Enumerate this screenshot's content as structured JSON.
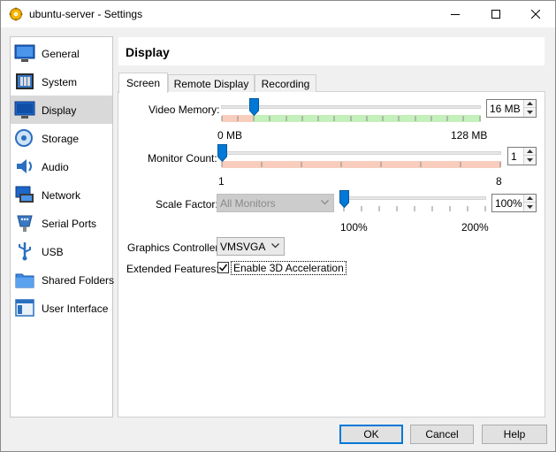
{
  "window": {
    "title": "ubuntu-server - Settings",
    "controls": [
      "minimize-icon",
      "maximize-icon",
      "close-icon"
    ]
  },
  "sidebar": {
    "items": [
      {
        "label": "General",
        "icon": "general-icon"
      },
      {
        "label": "System",
        "icon": "system-icon"
      },
      {
        "label": "Display",
        "icon": "display-icon",
        "selected": true
      },
      {
        "label": "Storage",
        "icon": "storage-icon"
      },
      {
        "label": "Audio",
        "icon": "audio-icon"
      },
      {
        "label": "Network",
        "icon": "network-icon"
      },
      {
        "label": "Serial Ports",
        "icon": "serial-ports-icon"
      },
      {
        "label": "USB",
        "icon": "usb-icon"
      },
      {
        "label": "Shared Folders",
        "icon": "shared-folders-icon"
      },
      {
        "label": "User Interface",
        "icon": "user-interface-icon"
      }
    ]
  },
  "main": {
    "title": "Display",
    "tabs": [
      {
        "label": "Screen",
        "active": true
      },
      {
        "label": "Remote Display"
      },
      {
        "label": "Recording"
      }
    ],
    "video_memory": {
      "label": "Video Memory:",
      "value": "16 MB",
      "value_mb": 16,
      "min_label": "0 MB",
      "max_label": "128 MB"
    },
    "monitor_count": {
      "label": "Monitor Count:",
      "value": "1",
      "min_label": "1",
      "max_label": "8"
    },
    "scale_factor": {
      "label": "Scale Factor:",
      "monitor_select": "All Monitors",
      "value": "100%",
      "min_label": "100%",
      "max_label": "200%"
    },
    "graphics_controller": {
      "label": "Graphics Controller:",
      "value": "VMSVGA"
    },
    "extended_features": {
      "label": "Extended Features:",
      "enable_3d_label": "Enable 3D Acceleration",
      "enable_3d_checked": true
    }
  },
  "buttons": {
    "ok": "OK",
    "cancel": "Cancel",
    "help": "Help"
  },
  "colors": {
    "accent": "#0078d7",
    "range_ok": "#c4f0bb",
    "range_bad": "#f8cdbd",
    "selected_bg": "#d9d9d9"
  }
}
